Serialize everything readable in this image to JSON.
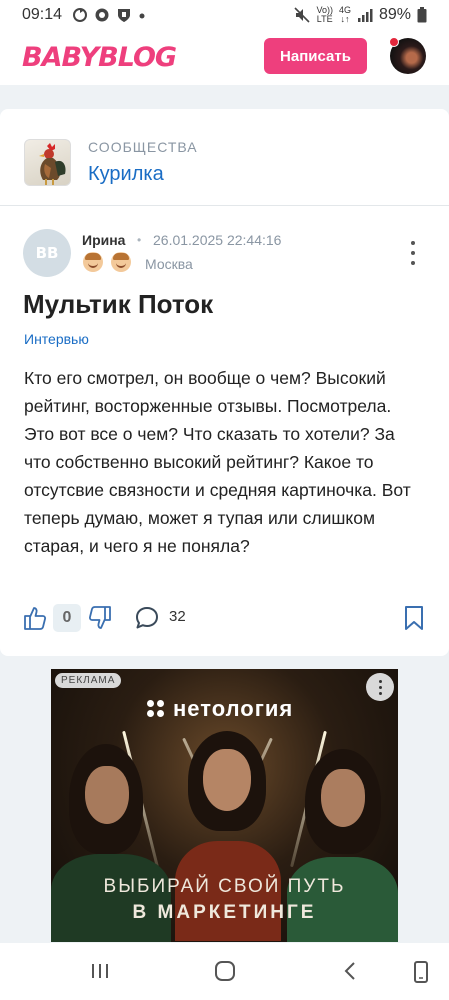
{
  "status_bar": {
    "time": "09:14",
    "battery": "89%",
    "network_top": "Vo))",
    "network_bottom": "LTE",
    "network_4g": "4G"
  },
  "header": {
    "logo": "BABYBLOG",
    "write_button": "Написать",
    "accent_color": "#ee3f7d"
  },
  "community": {
    "label": "СООБЩЕСТВА",
    "name": "Курилка"
  },
  "post": {
    "author_initials": "BB",
    "author": "Ирина",
    "date": "26.01.2025 22:44:16",
    "city": "Москва",
    "title": "Мультик Поток",
    "tag": "Интервью",
    "body": "Кто его смотрел, он вообще о чем? Высокий рейтинг, восторженные отзывы. Посмотрела. Это вот все о чем? Что сказать то хотели? За что собственно высокий рейтинг? Какое то отсутсвие связности и средняя картиночка. Вот теперь думаю, может я тупая или слишком старая, и чего я не поняла?",
    "likes": "0",
    "comments": "32"
  },
  "ad": {
    "label": "РЕКЛАМА",
    "brand": "нетология",
    "line1": "ВЫБИРАЙ СВОЙ ПУТЬ",
    "line2": "В МАРКЕТИНГЕ"
  }
}
